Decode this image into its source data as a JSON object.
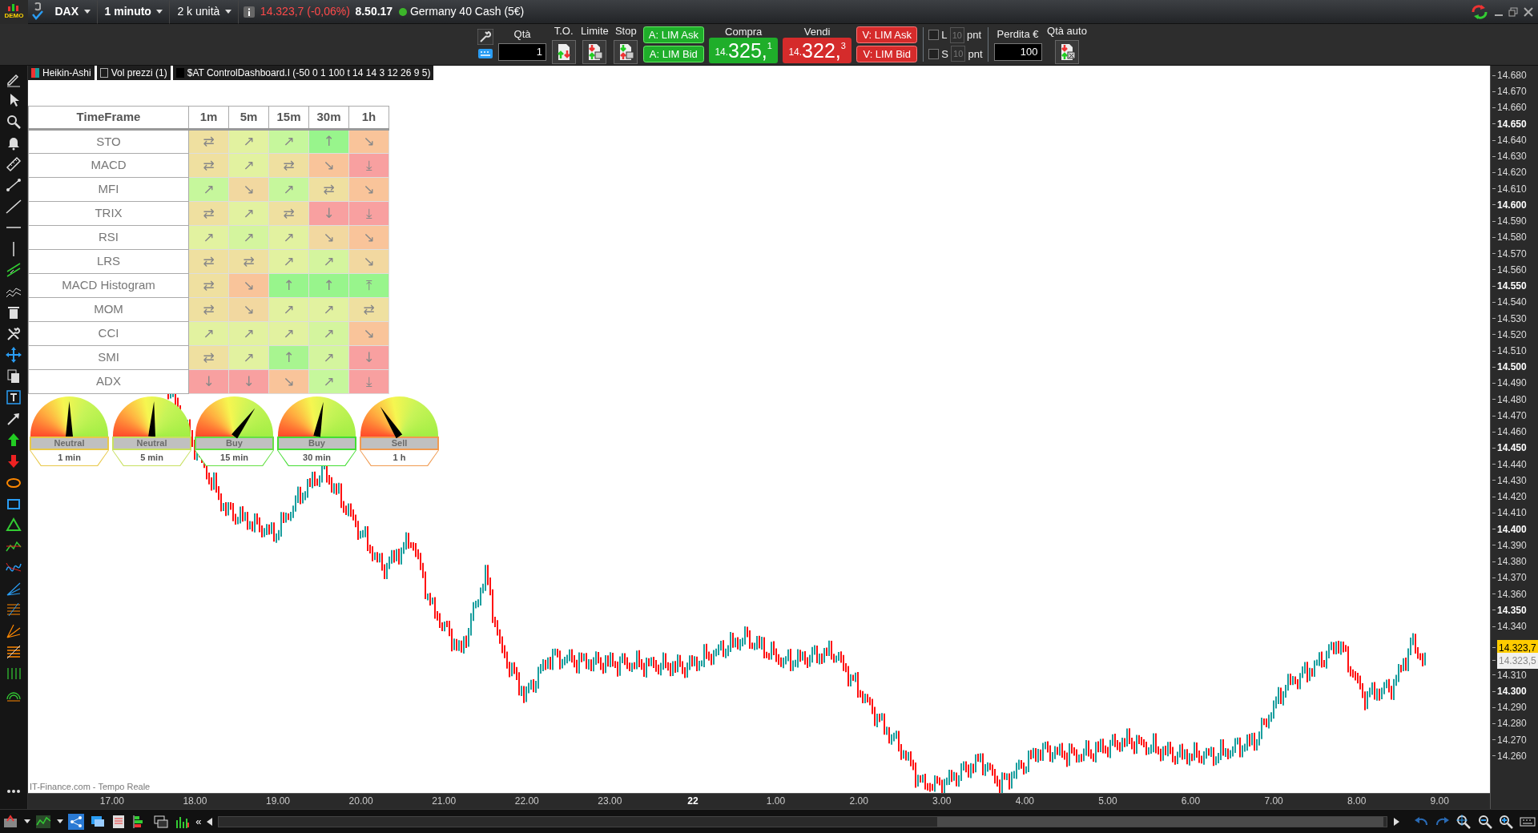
{
  "title_bar": {
    "logo": "DEMO",
    "symbol": "DAX",
    "timeframe": "1 minuto",
    "units": "2 k unità",
    "price_change": "14.323,7 (-0,06%)",
    "time": "8.50.17",
    "instrument": "Germany 40 Cash (5€)"
  },
  "order_bar": {
    "quantity_label": "Qtà",
    "quantity": "1",
    "to_label": "T.O.",
    "limit_label": "Limite",
    "stop_label": "Stop",
    "buy_buttons": [
      "A: LIM Ask",
      "A: LIM Bid"
    ],
    "buy": {
      "label": "Compra",
      "prefix": "14.",
      "main": "325,",
      "last": "1"
    },
    "sell": {
      "label": "Vendi",
      "prefix": "14.",
      "main": "322,",
      "last": "3"
    },
    "sell_buttons": [
      "V: LIM Ask",
      "V: LIM Bid"
    ],
    "long": {
      "label": "L",
      "checked": false,
      "value": "10",
      "unit": "pnt"
    },
    "short": {
      "label": "S",
      "checked": false,
      "value": "10",
      "unit": "pnt"
    },
    "loss_label": "Perdita €",
    "loss": "100",
    "auto_qty_label": "Qtà auto"
  },
  "legend": [
    {
      "kind": "candles",
      "label": "Heikin-Ashi"
    },
    {
      "kind": "checkbox",
      "label": "Vol prezzi (1)"
    },
    {
      "kind": "swatch",
      "label": "$AT ControlDashboard.I (-50 0 1 100 t 14 14 3 12 26 9 5)"
    }
  ],
  "dashboard": {
    "header": "TimeFrame",
    "columns": [
      "1m",
      "5m",
      "15m",
      "30m",
      "1h"
    ],
    "rows": [
      {
        "name": "STO",
        "cells": [
          {
            "arrow": "⇄",
            "color": "#efe0a0"
          },
          {
            "arrow": "↗",
            "color": "#e2f2a0"
          },
          {
            "arrow": "↗",
            "color": "#c6f79c"
          },
          {
            "arrow": "↑",
            "color": "#98f58c"
          },
          {
            "arrow": "↘",
            "color": "#f9c49a"
          }
        ]
      },
      {
        "name": "MACD",
        "cells": [
          {
            "arrow": "⇄",
            "color": "#efe0a0"
          },
          {
            "arrow": "↗",
            "color": "#e2f2a0"
          },
          {
            "arrow": "⇄",
            "color": "#efe0a0"
          },
          {
            "arrow": "↘",
            "color": "#f9c49a"
          },
          {
            "arrow": "⤓",
            "color": "#f8a0a0"
          }
        ]
      },
      {
        "name": "MFI",
        "cells": [
          {
            "arrow": "↗",
            "color": "#c6f79c"
          },
          {
            "arrow": "↘",
            "color": "#f2d8a0"
          },
          {
            "arrow": "↗",
            "color": "#c6f79c"
          },
          {
            "arrow": "⇄",
            "color": "#efe0a0"
          },
          {
            "arrow": "↘",
            "color": "#f9c49a"
          }
        ]
      },
      {
        "name": "TRIX",
        "cells": [
          {
            "arrow": "⇄",
            "color": "#efe0a0"
          },
          {
            "arrow": "↗",
            "color": "#e2f2a0"
          },
          {
            "arrow": "⇄",
            "color": "#efe0a0"
          },
          {
            "arrow": "↓",
            "color": "#f8a0a0"
          },
          {
            "arrow": "⤓",
            "color": "#f8a0a0"
          }
        ]
      },
      {
        "name": "RSI",
        "cells": [
          {
            "arrow": "↗",
            "color": "#e2f2a0"
          },
          {
            "arrow": "↗",
            "color": "#d4f59e"
          },
          {
            "arrow": "↗",
            "color": "#e2f2a0"
          },
          {
            "arrow": "↘",
            "color": "#f2d8a0"
          },
          {
            "arrow": "↘",
            "color": "#f9c49a"
          }
        ]
      },
      {
        "name": "LRS",
        "cells": [
          {
            "arrow": "⇄",
            "color": "#efe0a0"
          },
          {
            "arrow": "⇄",
            "color": "#efe0a0"
          },
          {
            "arrow": "↗",
            "color": "#e2f2a0"
          },
          {
            "arrow": "↗",
            "color": "#d4f59e"
          },
          {
            "arrow": "↘",
            "color": "#f2d8a0"
          }
        ]
      },
      {
        "name": "MACD Histogram",
        "cells": [
          {
            "arrow": "⇄",
            "color": "#efe0a0"
          },
          {
            "arrow": "↘",
            "color": "#f9c49a"
          },
          {
            "arrow": "↑",
            "color": "#98f58c"
          },
          {
            "arrow": "↑",
            "color": "#98f58c"
          },
          {
            "arrow": "⤒",
            "color": "#98f58c"
          }
        ]
      },
      {
        "name": "MOM",
        "cells": [
          {
            "arrow": "⇄",
            "color": "#efe0a0"
          },
          {
            "arrow": "↘",
            "color": "#f2d8a0"
          },
          {
            "arrow": "↗",
            "color": "#e2f2a0"
          },
          {
            "arrow": "↗",
            "color": "#e2f2a0"
          },
          {
            "arrow": "⇄",
            "color": "#efe0a0"
          }
        ]
      },
      {
        "name": "CCI",
        "cells": [
          {
            "arrow": "↗",
            "color": "#e2f2a0"
          },
          {
            "arrow": "↗",
            "color": "#e2f2a0"
          },
          {
            "arrow": "↗",
            "color": "#e2f2a0"
          },
          {
            "arrow": "↗",
            "color": "#d4f59e"
          },
          {
            "arrow": "↘",
            "color": "#f9c49a"
          }
        ]
      },
      {
        "name": "SMI",
        "cells": [
          {
            "arrow": "⇄",
            "color": "#efe0a0"
          },
          {
            "arrow": "↗",
            "color": "#e2f2a0"
          },
          {
            "arrow": "↑",
            "color": "#a8f590"
          },
          {
            "arrow": "↗",
            "color": "#d4f59e"
          },
          {
            "arrow": "↓",
            "color": "#f8a0a0"
          }
        ]
      },
      {
        "name": "ADX",
        "cells": [
          {
            "arrow": "↓",
            "color": "#f8a0a0"
          },
          {
            "arrow": "↓",
            "color": "#f8a0a0"
          },
          {
            "arrow": "↘",
            "color": "#f9c49a"
          },
          {
            "arrow": "↗",
            "color": "#c6f79c"
          },
          {
            "arrow": "⤓",
            "color": "#f8a0a0"
          }
        ]
      }
    ]
  },
  "gauges": [
    {
      "signal": "Neutral",
      "timeframe": "1 min",
      "level": 0.5,
      "color": "#e8c848"
    },
    {
      "signal": "Neutral",
      "timeframe": "5 min",
      "level": 0.52,
      "color": "#c8e060"
    },
    {
      "signal": "Buy",
      "timeframe": "15 min",
      "level": 0.7,
      "color": "#66e044"
    },
    {
      "signal": "Buy",
      "timeframe": "30 min",
      "level": 0.56,
      "color": "#44dd33"
    },
    {
      "signal": "Sell",
      "timeframe": "1 h",
      "level": 0.32,
      "color": "#f09a50"
    }
  ],
  "price_axis": [
    {
      "kind": "minor",
      "label": "14.680"
    },
    {
      "kind": "minor",
      "label": "14.670"
    },
    {
      "kind": "minor",
      "label": "14.660"
    },
    {
      "kind": "major",
      "label": "14.650"
    },
    {
      "kind": "minor",
      "label": "14.640"
    },
    {
      "kind": "minor",
      "label": "14.630"
    },
    {
      "kind": "minor",
      "label": "14.620"
    },
    {
      "kind": "minor",
      "label": "14.610"
    },
    {
      "kind": "major",
      "label": "14.600"
    },
    {
      "kind": "minor",
      "label": "14.590"
    },
    {
      "kind": "minor",
      "label": "14.580"
    },
    {
      "kind": "minor",
      "label": "14.570"
    },
    {
      "kind": "minor",
      "label": "14.560"
    },
    {
      "kind": "major",
      "label": "14.550"
    },
    {
      "kind": "minor",
      "label": "14.540"
    },
    {
      "kind": "minor",
      "label": "14.530"
    },
    {
      "kind": "minor",
      "label": "14.520"
    },
    {
      "kind": "minor",
      "label": "14.510"
    },
    {
      "kind": "major",
      "label": "14.500"
    },
    {
      "kind": "minor",
      "label": "14.490"
    },
    {
      "kind": "minor",
      "label": "14.480"
    },
    {
      "kind": "minor",
      "label": "14.470"
    },
    {
      "kind": "minor",
      "label": "14.460"
    },
    {
      "kind": "major",
      "label": "14.450"
    },
    {
      "kind": "minor",
      "label": "14.440"
    },
    {
      "kind": "minor",
      "label": "14.430"
    },
    {
      "kind": "minor",
      "label": "14.420"
    },
    {
      "kind": "minor",
      "label": "14.410"
    },
    {
      "kind": "major",
      "label": "14.400"
    },
    {
      "kind": "minor",
      "label": "14.390"
    },
    {
      "kind": "minor",
      "label": "14.380"
    },
    {
      "kind": "minor",
      "label": "14.370"
    },
    {
      "kind": "minor",
      "label": "14.360"
    },
    {
      "kind": "major",
      "label": "14.350"
    },
    {
      "kind": "minor",
      "label": "14.340"
    },
    {
      "kind": "last",
      "label": "14.323,7"
    },
    {
      "kind": "bid",
      "label": "14.323,5"
    },
    {
      "kind": "minor",
      "label": "14.310"
    },
    {
      "kind": "major",
      "label": "14.300"
    },
    {
      "kind": "minor",
      "label": "14.290"
    },
    {
      "kind": "minor",
      "label": "14.280"
    },
    {
      "kind": "minor",
      "label": "14.270"
    },
    {
      "kind": "minor",
      "label": "14.260"
    }
  ],
  "time_axis": [
    {
      "label": "17.00",
      "major": false
    },
    {
      "label": "18.00",
      "major": false
    },
    {
      "label": "19.00",
      "major": false
    },
    {
      "label": "20.00",
      "major": false
    },
    {
      "label": "21.00",
      "major": false
    },
    {
      "label": "22.00",
      "major": false
    },
    {
      "label": "23.00",
      "major": false
    },
    {
      "label": "22",
      "major": true
    },
    {
      "label": "1.00",
      "major": false
    },
    {
      "label": "2.00",
      "major": false
    },
    {
      "label": "3.00",
      "major": false
    },
    {
      "label": "4.00",
      "major": false
    },
    {
      "label": "5.00",
      "major": false
    },
    {
      "label": "6.00",
      "major": false
    },
    {
      "label": "7.00",
      "major": false
    },
    {
      "label": "8.00",
      "major": false
    },
    {
      "label": "9.00",
      "major": false
    }
  ],
  "source_note": "IT-Finance.com - Tempo Reale",
  "bottom_bar": {
    "scroll_back": "«"
  }
}
